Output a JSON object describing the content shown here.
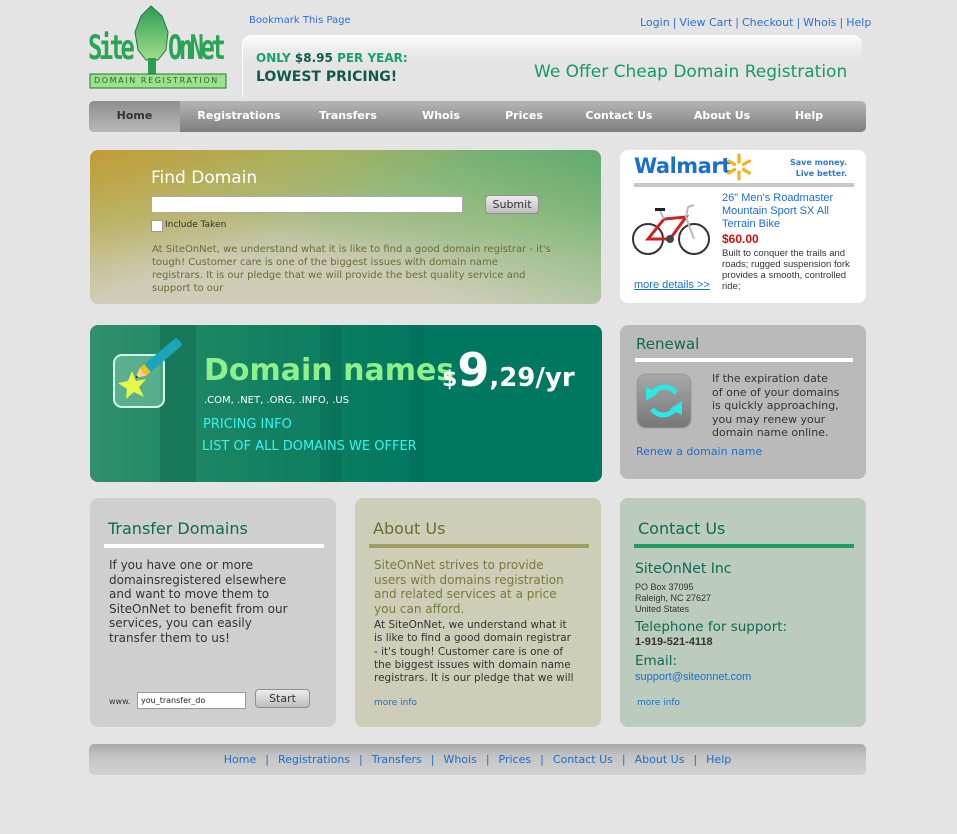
{
  "header": {
    "logo": {
      "word1": "Site",
      "word2": "OnNet",
      "subtitle": "DOMAIN REGISTRATION"
    },
    "bookmark_label": "Bookmark This Page",
    "top_links": [
      "Login",
      "View Cart",
      "Checkout",
      "Whois",
      "Help"
    ],
    "promo_only": "ONLY",
    "promo_price": "$8.95",
    "promo_per_year": "PER YEAR:",
    "promo_lowest": "LOWEST PRICING!",
    "tagline": "We Offer Cheap Domain Registration"
  },
  "nav": {
    "items": [
      "Home",
      "Registrations",
      "Transfers",
      "Whois",
      "Prices",
      "Contact Us",
      "About Us",
      "Help"
    ],
    "active": "Home"
  },
  "find_domain": {
    "title": "Find Domain",
    "input_value": "",
    "submit_label": "Submit",
    "checkbox_label": "Include Taken",
    "checkbox_checked": false,
    "text": "At SiteOnNet, we understand what it is like to find a good domain registrar - it's tough! Customer care is one of the biggest issues with domain name registrars. It is our pledge that we will provide the best quality service and support to our"
  },
  "ad": {
    "brand": "Walmart",
    "slogan_line1": "Save money.",
    "slogan_line2": "Live better.",
    "product_title": "26\" Men's Roadmaster Mountain Sport SX All Terrain Bike",
    "price": "$60.00",
    "description": "Built to conquer the trails and roads; rugged suspension fork provides a smooth, controlled ride;",
    "more_label": "more details >>"
  },
  "domain_promo": {
    "title": "Domain names",
    "price_currency": "$",
    "price_major": "9",
    "price_rest": ",29/yr",
    "tlds": ".COM, .NET, .ORG, .INFO, .US",
    "link_pricing": "PRICING INFO",
    "link_list": "LIST OF ALL DOMAINS WE OFFER"
  },
  "renewal": {
    "title": "Renewal",
    "text": "If the expiration date of one of your domains is quickly approaching, you may renew your domain name online.",
    "link": "Renew a domain name"
  },
  "transfer": {
    "title": "Transfer Domains",
    "text": "If you have one or more domainsregistered elsewhere and want to move them to SiteOnNet to benefit from our services, you can easily transfer them to us!",
    "prefix": "www.",
    "input_value": "you_transfer_do",
    "start_label": "Start"
  },
  "about": {
    "title": "About Us",
    "intro": "SiteOnNet strives to provide users with domains registration and related services at a price you can afford.",
    "text": "At SiteOnNet, we understand what it is like to find a good domain registrar - it's tough! Customer care is one of the biggest issues with domain name registrars. It is our pledge that we will",
    "more_label": "more info"
  },
  "contact": {
    "title": "Contact Us",
    "company": "SiteOnNet Inc",
    "address_line1": "PO Box 37095",
    "address_line2": "Raleigh, NC 27627",
    "address_line3": "United States",
    "tel_label": "Telephone for support:",
    "tel": "1-919-521-4118",
    "email_label": "Email:",
    "email": "support@siteonnet.com",
    "more_label": "more info"
  },
  "footer": {
    "links": [
      "Home",
      "Registrations",
      "Transfers",
      "Whois",
      "Prices",
      "Contact Us",
      "About Us",
      "Help"
    ]
  },
  "colors": {
    "brand_green": "#159a63",
    "dark_teal": "#0f5a50",
    "link_blue": "#1a6fce",
    "promo_bg": "#00785f",
    "page_bg": "#e4e4e4"
  }
}
